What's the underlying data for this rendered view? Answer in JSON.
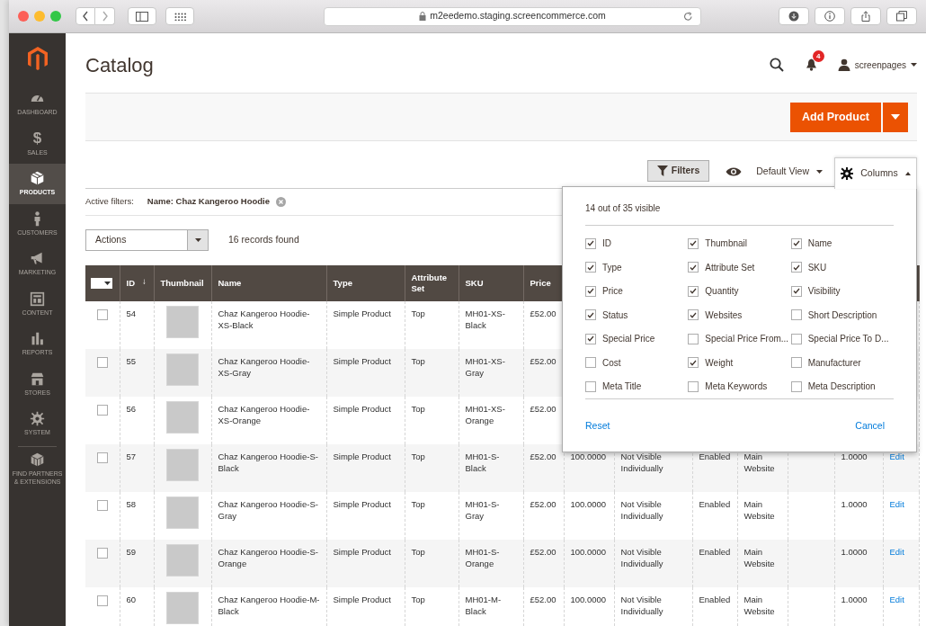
{
  "browser": {
    "url": "m2eedemo.staging.screencommerce.com"
  },
  "sidebar": {
    "items": [
      {
        "label": "DASHBOARD",
        "kind": "gauge",
        "selected": false,
        "divider_before": false
      },
      {
        "label": "SALES",
        "kind": "glyph",
        "glyph": "$",
        "selected": false,
        "divider_before": false
      },
      {
        "label": "PRODUCTS",
        "kind": "box",
        "selected": true,
        "divider_before": false
      },
      {
        "label": "CUSTOMERS",
        "kind": "person",
        "selected": false,
        "divider_before": false
      },
      {
        "label": "MARKETING",
        "kind": "megaphone",
        "selected": false,
        "divider_before": false
      },
      {
        "label": "CONTENT",
        "kind": "layout",
        "selected": false,
        "divider_before": false
      },
      {
        "label": "REPORTS",
        "kind": "bars",
        "selected": false,
        "divider_before": false
      },
      {
        "label": "STORES",
        "kind": "store",
        "selected": false,
        "divider_before": false
      },
      {
        "label": "SYSTEM",
        "kind": "gear",
        "selected": false,
        "divider_before": false
      },
      {
        "label": "FIND PARTNERS\n& EXTENSIONS",
        "kind": "cubes",
        "selected": false,
        "divider_before": true
      }
    ]
  },
  "header": {
    "title": "Catalog",
    "notifications": "4",
    "user": "screenpages"
  },
  "page_actions": {
    "primary": "Add Product"
  },
  "toolbar": {
    "filters": "Filters",
    "view": "Default View",
    "columns": "Columns",
    "columns_expanded": true
  },
  "active_filters": {
    "label": "Active filters:",
    "filters": [
      "Name: Chaz Kangeroo Hoodie"
    ]
  },
  "mass_actions": {
    "select": "Actions",
    "records": "16 records found"
  },
  "columns_panel": {
    "summary": "14 out of 35 visible",
    "options": [
      {
        "label": "ID",
        "checked": true
      },
      {
        "label": "Thumbnail",
        "checked": true
      },
      {
        "label": "Name",
        "checked": true
      },
      {
        "label": "Type",
        "checked": true
      },
      {
        "label": "Attribute Set",
        "checked": true
      },
      {
        "label": "SKU",
        "checked": true
      },
      {
        "label": "Price",
        "checked": true
      },
      {
        "label": "Quantity",
        "checked": true
      },
      {
        "label": "Visibility",
        "checked": true
      },
      {
        "label": "Status",
        "checked": true
      },
      {
        "label": "Websites",
        "checked": true
      },
      {
        "label": "Short Description",
        "checked": false
      },
      {
        "label": "Special Price",
        "checked": true
      },
      {
        "label": "Special Price From...",
        "checked": false
      },
      {
        "label": "Special Price To D...",
        "checked": false
      },
      {
        "label": "Cost",
        "checked": false
      },
      {
        "label": "Weight",
        "checked": true
      },
      {
        "label": "Manufacturer",
        "checked": false
      },
      {
        "label": "Meta Title",
        "checked": false
      },
      {
        "label": "Meta Keywords",
        "checked": false
      },
      {
        "label": "Meta Description",
        "checked": false
      }
    ],
    "reset": "Reset",
    "cancel": "Cancel"
  },
  "table": {
    "select_all_checked": false,
    "columns": [
      {
        "label": "ID",
        "sort_indicator": "↓"
      },
      {
        "label": "Thumbnail"
      },
      {
        "label": "Name"
      },
      {
        "label": "Type"
      },
      {
        "label": "Attribute Set"
      },
      {
        "label": "SKU"
      },
      {
        "label": "Price"
      }
    ],
    "rows": [
      {
        "checked": false,
        "id": "54",
        "name": "Chaz Kangeroo Hoodie-XS-Black",
        "type": "Simple Product",
        "attribute_set": "Top",
        "sku": "MH01-XS-Black",
        "price": "£52.00"
      },
      {
        "checked": false,
        "id": "55",
        "name": "Chaz Kangeroo Hoodie-XS-Gray",
        "type": "Simple Product",
        "attribute_set": "Top",
        "sku": "MH01-XS-Gray",
        "price": "£52.00"
      },
      {
        "checked": false,
        "id": "56",
        "name": "Chaz Kangeroo Hoodie-XS-Orange",
        "type": "Simple Product",
        "attribute_set": "Top",
        "sku": "MH01-XS-Orange",
        "price": "£52.00"
      },
      {
        "checked": false,
        "id": "57",
        "name": "Chaz Kangeroo Hoodie-S-Black",
        "type": "Simple Product",
        "attribute_set": "Top",
        "sku": "MH01-S-Black",
        "price": "£52.00",
        "quantity": "100.0000",
        "visibility": "Not Visible Individually",
        "status": "Enabled",
        "websites": "Main Website",
        "weight": "1.0000",
        "action": "Edit"
      },
      {
        "checked": false,
        "id": "58",
        "name": "Chaz Kangeroo Hoodie-S-Gray",
        "type": "Simple Product",
        "attribute_set": "Top",
        "sku": "MH01-S-Gray",
        "price": "£52.00",
        "quantity": "100.0000",
        "visibility": "Not Visible Individually",
        "status": "Enabled",
        "websites": "Main Website",
        "weight": "1.0000",
        "action": "Edit"
      },
      {
        "checked": false,
        "id": "59",
        "name": "Chaz Kangeroo Hoodie-S-Orange",
        "type": "Simple Product",
        "attribute_set": "Top",
        "sku": "MH01-S-Orange",
        "price": "£52.00",
        "quantity": "100.0000",
        "visibility": "Not Visible Individually",
        "status": "Enabled",
        "websites": "Main Website",
        "weight": "1.0000",
        "action": "Edit"
      },
      {
        "checked": false,
        "id": "60",
        "name": "Chaz Kangeroo Hoodie-M-Black",
        "type": "Simple Product",
        "attribute_set": "Top",
        "sku": "MH01-M-Black",
        "price": "£52.00",
        "quantity": "100.0000",
        "visibility": "Not Visible Individually",
        "status": "Enabled",
        "websites": "Main Website",
        "weight": "1.0000",
        "action": "Edit"
      }
    ]
  }
}
